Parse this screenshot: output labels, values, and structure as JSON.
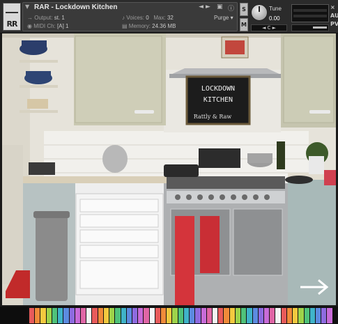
{
  "header": {
    "instrument_name": "RAR - Lockdown Kitchen",
    "output_label": "Output:",
    "output_value": "st. 1",
    "midi_label": "MIDI Ch:",
    "midi_value": "[A] 1",
    "voices_label": "Voices:",
    "voices_value": "0",
    "max_label": "Max:",
    "max_value": "32",
    "memory_label": "Memory:",
    "memory_value": "24.36 MB",
    "purge_label": "Purge",
    "solo_label": "S",
    "mute_label": "M",
    "tune_label": "Tune",
    "tune_value": "0.00",
    "pan_label": "◄ C ►",
    "aux_label": "AUX",
    "pv_label": "PV"
  },
  "stage": {
    "chalkboard_lines": [
      "LOCKDOWN",
      "KITCHEN"
    ],
    "chalkboard_signature": "Rattly & Raw",
    "arrow": "next-page-arrow"
  },
  "keyboard": {
    "key_colors": [
      "#e85b5b",
      "#f08b3a",
      "#f3c93f",
      "#9ed34a",
      "#4fc27a",
      "#3fb3c9",
      "#5c8be0",
      "#8e6be0",
      "#c86bd8",
      "#e066a6",
      "#f5f5f5",
      "#e85b5b",
      "#f08b3a",
      "#f3c93f",
      "#9ed34a",
      "#4fc27a",
      "#3fb3c9",
      "#5c8be0",
      "#8e6be0",
      "#c86bd8",
      "#e066a6",
      "#f5f5f5",
      "#e85b5b",
      "#f08b3a",
      "#f3c93f",
      "#9ed34a",
      "#4fc27a",
      "#3fb3c9",
      "#5c8be0",
      "#8e6be0",
      "#c86bd8",
      "#e066a6",
      "#f5f5f5",
      "#e85b5b",
      "#f08b3a",
      "#f3c93f",
      "#9ed34a",
      "#4fc27a",
      "#3fb3c9",
      "#5c8be0",
      "#8e6be0",
      "#c86bd8",
      "#e066a6",
      "#f5f5f5",
      "#e85b5b",
      "#f08b3a",
      "#f3c93f",
      "#9ed34a",
      "#4fc27a",
      "#3fb3c9",
      "#5c8be0",
      "#8e6be0",
      "#c86bd8"
    ]
  }
}
